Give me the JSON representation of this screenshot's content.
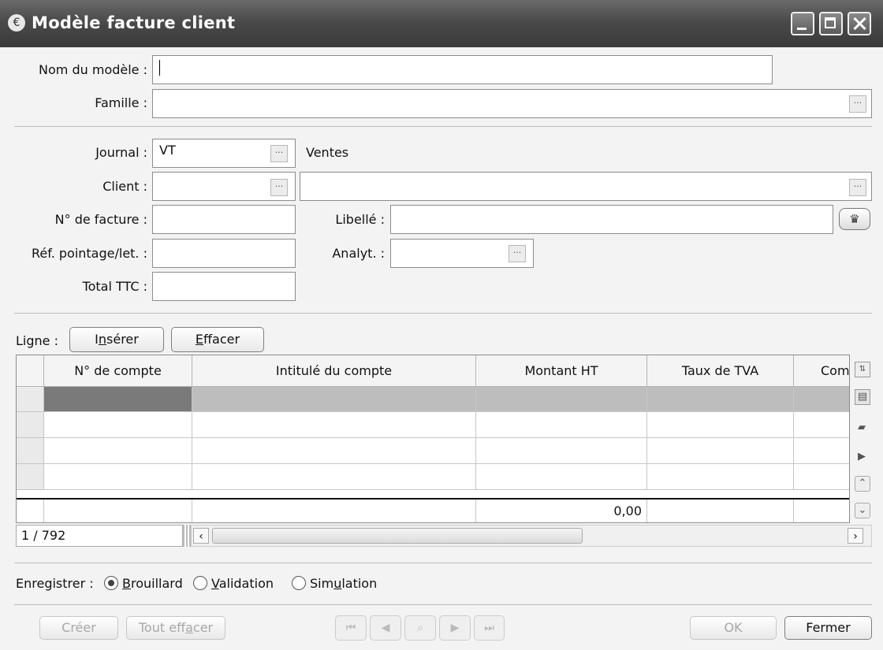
{
  "window": {
    "title": "Modèle facture client"
  },
  "form": {
    "nom_label": "Nom du modèle :",
    "nom_value": "",
    "famille_label": "Famille :",
    "famille_value": "",
    "journal_label": "Journal :",
    "journal_value": "VT",
    "journal_name": "Ventes",
    "client_label": "Client :",
    "client_value": "",
    "client_name": "",
    "facture_label": "N° de facture :",
    "facture_value": "",
    "libelle_label": "Libellé :",
    "libelle_value": "",
    "ref_label": "Réf. pointage/let. :",
    "ref_value": "",
    "analyt_label": "Analyt. :",
    "analyt_value": "",
    "total_label": "Total TTC :",
    "total_value": ""
  },
  "ligne": {
    "label": "Ligne :",
    "insert_pre": "I",
    "insert_u": "n",
    "insert_post": "sérer",
    "erase_u": "E",
    "erase_post": "ffacer"
  },
  "grid": {
    "columns": [
      "N° de compte",
      "Intitulé du compte",
      "Montant HT",
      "Taux de TVA",
      "Com"
    ],
    "total_montant": "0,00",
    "record_position": "1 / 792"
  },
  "save": {
    "label": "Enregistrer :",
    "selected": "Brouillard",
    "options": [
      {
        "pre": "",
        "u": "B",
        "post": "rouillard"
      },
      {
        "pre": "",
        "u": "V",
        "post": "alidation"
      },
      {
        "pre": "Sim",
        "u": "u",
        "post": "lation"
      }
    ]
  },
  "buttons": {
    "creer": "Créer",
    "tout_pre": "Tout eff",
    "tout_u": "a",
    "tout_post": "cer",
    "ok": "OK",
    "fermer": "Fermer"
  },
  "icons": [
    "app-icon",
    "minimize-icon",
    "maximize-icon",
    "close-icon",
    "ellipsis-icon",
    "attach-icon",
    "sort-icon",
    "screen-icon",
    "print-icon",
    "arrow-right-icon",
    "chevron-up-icon",
    "chevron-down-icon",
    "first-icon",
    "prev-icon",
    "search-icon",
    "next-icon",
    "last-icon"
  ]
}
